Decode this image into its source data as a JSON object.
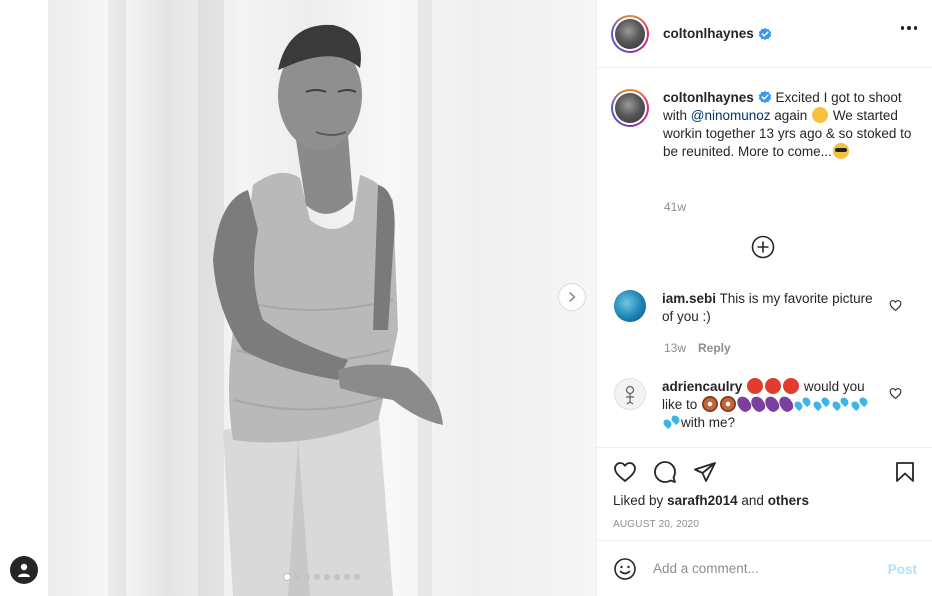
{
  "post": {
    "username": "coltonlhaynes",
    "caption_prefix": "Excited I got to shoot with ",
    "caption_mention": "@ninomunoz",
    "caption_middle": " again ",
    "caption_rest": " We started workin together 13 yrs ago & so stoked to be reunited. More to come...",
    "caption_time": "41w",
    "liked_by_label": "Liked by",
    "liked_by_user": "sarafh2014",
    "liked_by_and": "and",
    "liked_by_others": "others",
    "date": "AUGUST 20, 2020",
    "carousel_count": 8,
    "carousel_active": 0
  },
  "comments": [
    {
      "username": "iam.sebi",
      "text": "This is my favorite picture of you :)",
      "time": "13w",
      "reply_label": "Reply"
    },
    {
      "username": "adriencaulry",
      "text_a": "would you like to",
      "text_b": "with me?"
    }
  ],
  "comment_box": {
    "placeholder": "Add a comment...",
    "post_label": "Post"
  },
  "icons": {
    "verified": "verified-badge-icon",
    "more": "more-options-icon",
    "load_more": "plus-circle-icon",
    "like": "heart-icon",
    "comment": "comment-icon",
    "share": "send-icon",
    "save": "bookmark-icon",
    "emoji": "smiley-icon",
    "next": "chevron-right-icon",
    "profile": "user-icon"
  },
  "colors": {
    "accent_link": "#00376b",
    "verified_blue": "#3897f0",
    "post_button_disabled": "#b2dffc",
    "muted_text": "#8e8e8e"
  }
}
